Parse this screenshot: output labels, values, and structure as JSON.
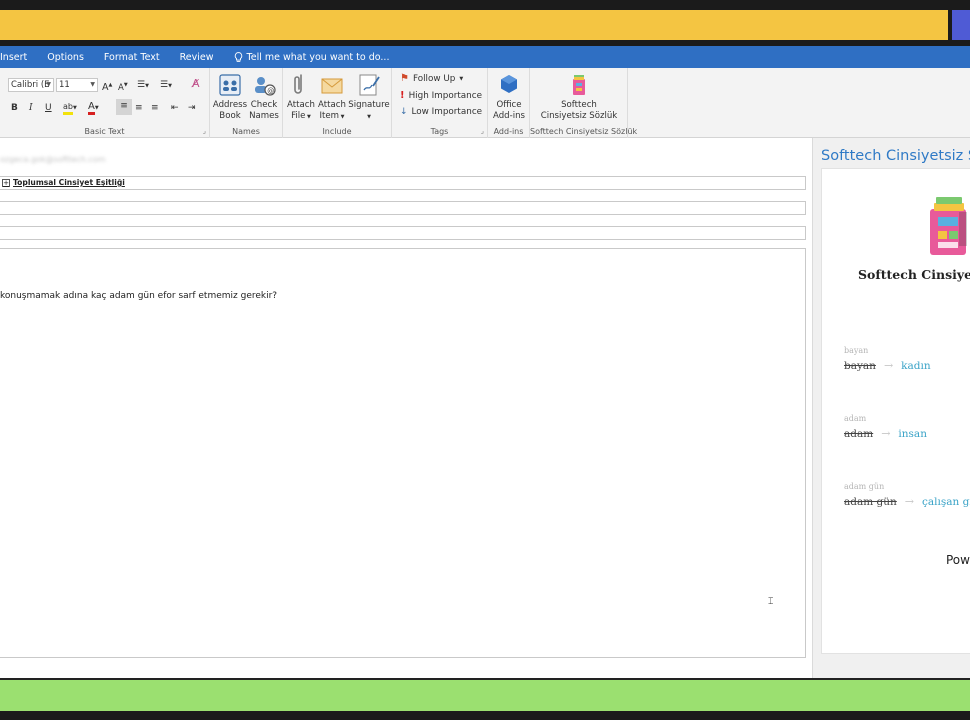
{
  "menu": {
    "items": [
      "Insert",
      "Options",
      "Format Text",
      "Review"
    ],
    "tell_me": "Tell me what you want to do..."
  },
  "ribbon": {
    "basic_text": {
      "label": "Basic Text",
      "font_name": "Calibri (E",
      "font_size": "11",
      "bold": "B",
      "italic": "I",
      "underline": "U"
    },
    "names": {
      "label": "Names",
      "address_book": [
        "Address",
        "Book"
      ],
      "check_names": [
        "Check",
        "Names"
      ]
    },
    "include": {
      "label": "Include",
      "attach_file": [
        "Attach",
        "File"
      ],
      "attach_item": [
        "Attach",
        "Item"
      ],
      "signature": [
        "Signature",
        ""
      ]
    },
    "tags": {
      "label": "Tags",
      "follow_up": "Follow Up",
      "high_importance": "High Importance",
      "low_importance": "Low Importance"
    },
    "addins": {
      "label": "Add-ins",
      "office_addins": [
        "Office",
        "Add-ins"
      ]
    },
    "softtech": {
      "label": "Softtech Cinsiyetsiz Sözlük",
      "button": [
        "Softtech",
        "Cinsiyetsiz Sözlük"
      ]
    }
  },
  "compose": {
    "from_blurred": "ozgeca.gok@softtech.com",
    "attachment": "Toplumsal Cinsiyet Eşitliği",
    "body": "konuşmamak adına kaç adam gün efor sarf etmemiz gerekir?"
  },
  "side_pane": {
    "title": "Softtech Cinsiyetsiz S",
    "addin_name": "Softtech Cinsiyet",
    "entries": [
      {
        "label": "bayan",
        "old": "bayan",
        "new": "kadın"
      },
      {
        "label": "adam",
        "old": "adam",
        "new": "insan"
      },
      {
        "label": "adam gün",
        "old": "adam gün",
        "new": "çalışan gi"
      }
    ],
    "powered": "Pow"
  },
  "colors": {
    "accent_blue": "#2f6fc3",
    "yellow": "#f4c542",
    "green": "#9be070",
    "suggestion": "#3aa3c7"
  }
}
